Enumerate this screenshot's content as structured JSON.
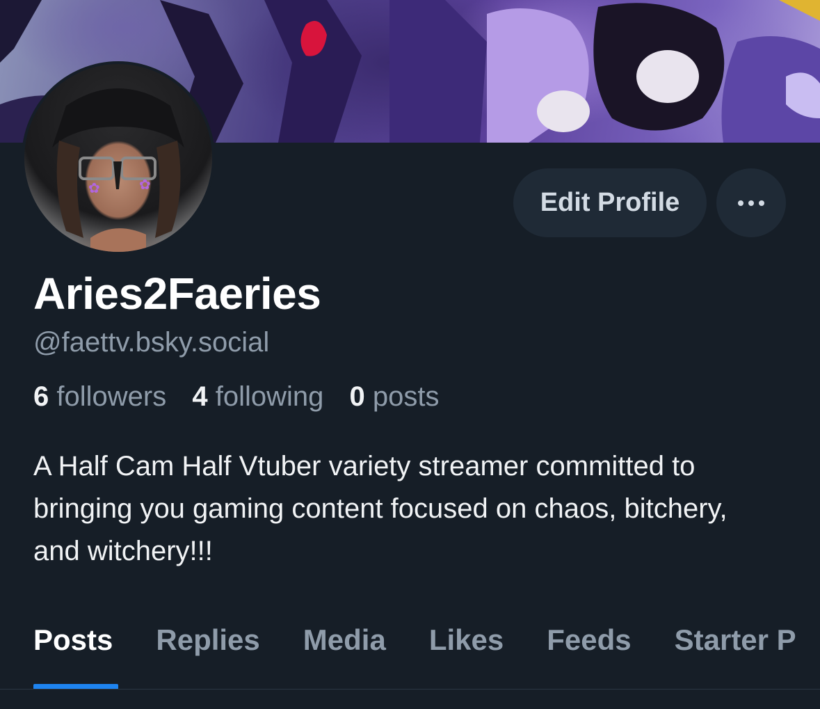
{
  "profile": {
    "display_name": "Aries2Faeries",
    "handle": "@faettv.bsky.social",
    "bio": "A Half Cam Half Vtuber variety streamer committed to bringing you gaming content focused on chaos, bitchery, and witchery!!!"
  },
  "actions": {
    "edit_profile_label": "Edit Profile",
    "more_icon": "more-horizontal-icon"
  },
  "stats": {
    "followers_count": "6",
    "followers_label": "followers",
    "following_count": "4",
    "following_label": "following",
    "posts_count": "0",
    "posts_label": "posts"
  },
  "tabs": [
    {
      "label": "Posts",
      "active": true
    },
    {
      "label": "Replies",
      "active": false
    },
    {
      "label": "Media",
      "active": false
    },
    {
      "label": "Likes",
      "active": false
    },
    {
      "label": "Feeds",
      "active": false
    },
    {
      "label": "Starter P",
      "active": false
    }
  ],
  "colors": {
    "background": "#161e27",
    "accent": "#1e84f0",
    "button_bg": "#1f2a36",
    "muted_text": "#8f9caa"
  }
}
